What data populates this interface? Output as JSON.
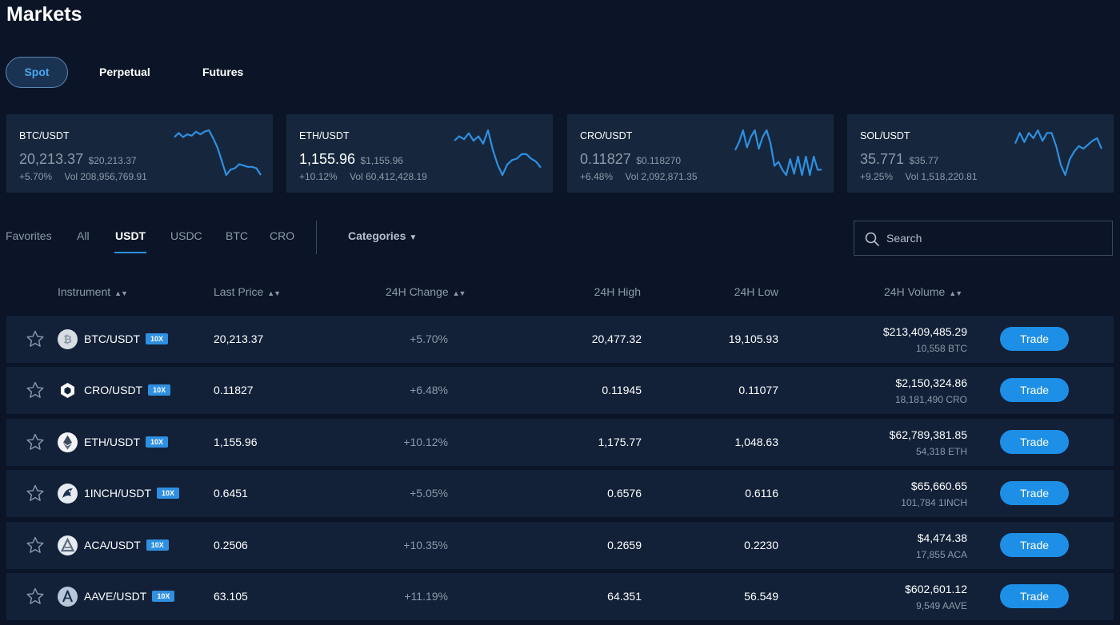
{
  "title": "Markets",
  "market_tabs": [
    {
      "label": "Spot",
      "active": true
    },
    {
      "label": "Perpetual",
      "active": false
    },
    {
      "label": "Futures",
      "active": false
    }
  ],
  "tickers": [
    {
      "pair": "BTC/USDT",
      "price": "20,213.37",
      "usd": "$20,213.37",
      "change": "+5.70%",
      "vol_label": "Vol",
      "volume": "208,956,769.91",
      "spark": [
        14,
        17,
        14,
        16,
        15,
        18,
        16,
        18,
        19,
        13,
        6,
        -4,
        -14,
        -10,
        -9,
        -6,
        -7,
        -8,
        -8,
        -9,
        -14
      ]
    },
    {
      "pair": "ETH/USDT",
      "price": "1,155.96",
      "usd": "$1,155.96",
      "change": "+10.12%",
      "vol_label": "Vol",
      "volume": "60,412,428.19",
      "spark": [
        6,
        9,
        7,
        11,
        6,
        9,
        4,
        13,
        0,
        -10,
        -17,
        -10,
        -7,
        -6,
        -3,
        -3,
        -6,
        -8,
        -12
      ]
    },
    {
      "pair": "CRO/USDT",
      "price": "0.11827",
      "usd": "$0.118270",
      "change": "+6.48%",
      "vol_label": "Vol",
      "volume": "2,092,871.35",
      "spark": [
        5,
        11,
        20,
        7,
        15,
        20,
        6,
        15,
        20,
        10,
        -7,
        -4,
        -10,
        -14,
        -2,
        -13,
        0,
        -14,
        0,
        -14,
        0,
        -10,
        -10
      ]
    },
    {
      "pair": "SOL/USDT",
      "price": "35.771",
      "usd": "$35.77",
      "change": "+9.25%",
      "vol_label": "Vol",
      "volume": "1,518,220.81",
      "spark": [
        6,
        14,
        7,
        14,
        10,
        16,
        8,
        14,
        14,
        4,
        -10,
        -18,
        -6,
        0,
        4,
        2,
        5,
        8,
        10,
        2
      ]
    }
  ],
  "filter_tabs": [
    "Favorites",
    "All",
    "USDT",
    "USDC",
    "BTC",
    "CRO"
  ],
  "filter_active": "USDT",
  "categories_label": "Categories",
  "search": {
    "placeholder": "Search"
  },
  "columns": {
    "instrument": "Instrument",
    "last_price": "Last Price",
    "change": "24H Change",
    "high": "24H High",
    "low": "24H Low",
    "volume": "24H Volume"
  },
  "rows": [
    {
      "instrument": "BTC/USDT",
      "leverage": "10X",
      "last_price": "20,213.37",
      "change": "+5.70%",
      "high": "20,477.32",
      "low": "19,105.93",
      "volume_usd": "$213,409,485.29",
      "volume_base": "10,558 BTC",
      "trade_label": "Trade",
      "coin_icon": "bitcoin-icon",
      "icon_color": "#d8dde3"
    },
    {
      "instrument": "CRO/USDT",
      "leverage": "10X",
      "last_price": "0.11827",
      "change": "+6.48%",
      "high": "0.11945",
      "low": "0.11077",
      "volume_usd": "$2,150,324.86",
      "volume_base": "18,181,490 CRO",
      "trade_label": "Trade",
      "coin_icon": "cronos-icon",
      "icon_color": "#ffffff"
    },
    {
      "instrument": "ETH/USDT",
      "leverage": "10X",
      "last_price": "1,155.96",
      "change": "+10.12%",
      "high": "1,175.77",
      "low": "1,048.63",
      "volume_usd": "$62,789,381.85",
      "volume_base": "54,318 ETH",
      "trade_label": "Trade",
      "coin_icon": "ethereum-icon",
      "icon_color": "#f2f4f7"
    },
    {
      "instrument": "1INCH/USDT",
      "leverage": "10X",
      "last_price": "0.6451",
      "change": "+5.05%",
      "high": "0.6576",
      "low": "0.6116",
      "volume_usd": "$65,660.65",
      "volume_base": "101,784 1INCH",
      "trade_label": "Trade",
      "coin_icon": "1inch-icon",
      "icon_color": "#e6ebf2"
    },
    {
      "instrument": "ACA/USDT",
      "leverage": "10X",
      "last_price": "0.2506",
      "change": "+10.35%",
      "high": "0.2659",
      "low": "0.2230",
      "volume_usd": "$4,474.38",
      "volume_base": "17,855 ACA",
      "trade_label": "Trade",
      "coin_icon": "acala-icon",
      "icon_color": "#e6ebf2"
    },
    {
      "instrument": "AAVE/USDT",
      "leverage": "10X",
      "last_price": "63.105",
      "change": "+11.19%",
      "high": "64.351",
      "low": "56.549",
      "volume_usd": "$602,601.12",
      "volume_base": "9,549 AAVE",
      "trade_label": "Trade",
      "coin_icon": "aave-icon",
      "icon_color": "#b8c7d8"
    }
  ],
  "colors": {
    "accent": "#2f8fe0",
    "background": "#0b1527",
    "card": "#16273d",
    "row": "#122138",
    "muted": "#8e99a8"
  }
}
